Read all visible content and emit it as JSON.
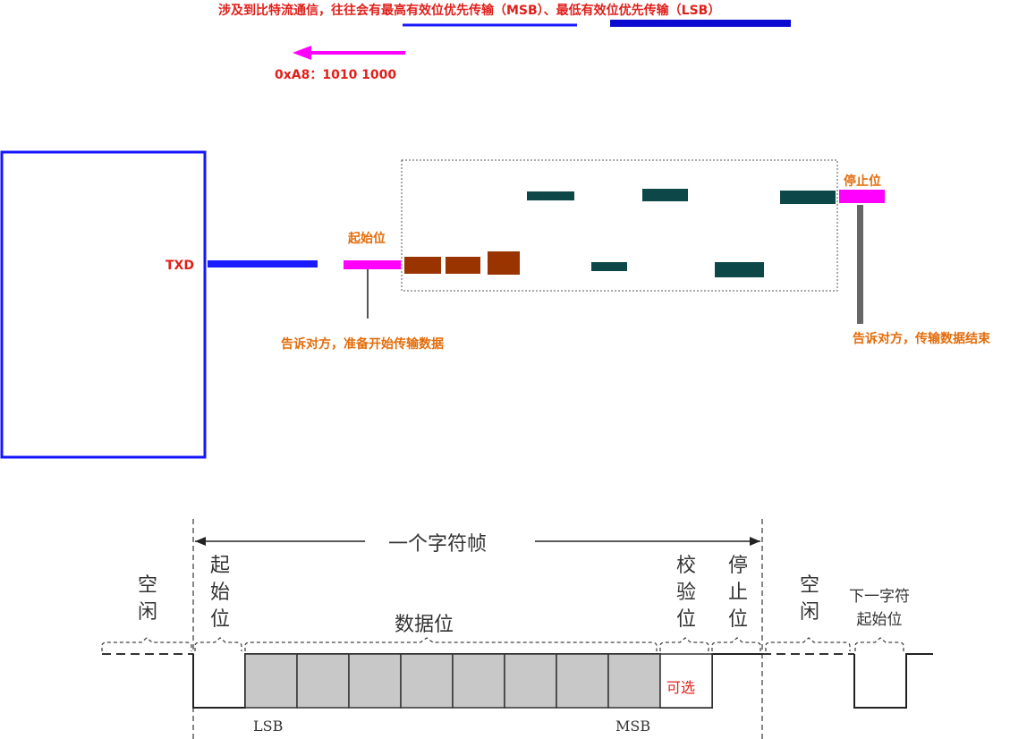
{
  "top": {
    "title": "涉及到比特流通信，往往会有最高有效位优先传输（MSB）、最低有效位优先传输（LSB）",
    "example": "0xA8：1010 1000"
  },
  "mid": {
    "txd_label": "TXD",
    "start_label": "起始位",
    "start_note": "告诉对方，准备开始传输数据",
    "stop_label": "停止位",
    "stop_note": "告诉对方，传输数据结束"
  },
  "frame": {
    "title": "一个字符帧",
    "idle1": [
      "空",
      "闲"
    ],
    "start": [
      "起",
      "始",
      "位"
    ],
    "data": "数据位",
    "parity": [
      "校",
      "验",
      "位"
    ],
    "stop": [
      "停",
      "止",
      "位"
    ],
    "idle2": [
      "空",
      "闲"
    ],
    "next_start": [
      "下一字符",
      "起始位"
    ],
    "optional": "可选",
    "lsb": "LSB",
    "msb": "MSB"
  },
  "colors": {
    "red": "#e0201b",
    "orange": "#e36c0a",
    "blue": "#1a1aff",
    "magenta": "#ff00ff",
    "brown": "#993300",
    "teal": "#0d4747"
  }
}
